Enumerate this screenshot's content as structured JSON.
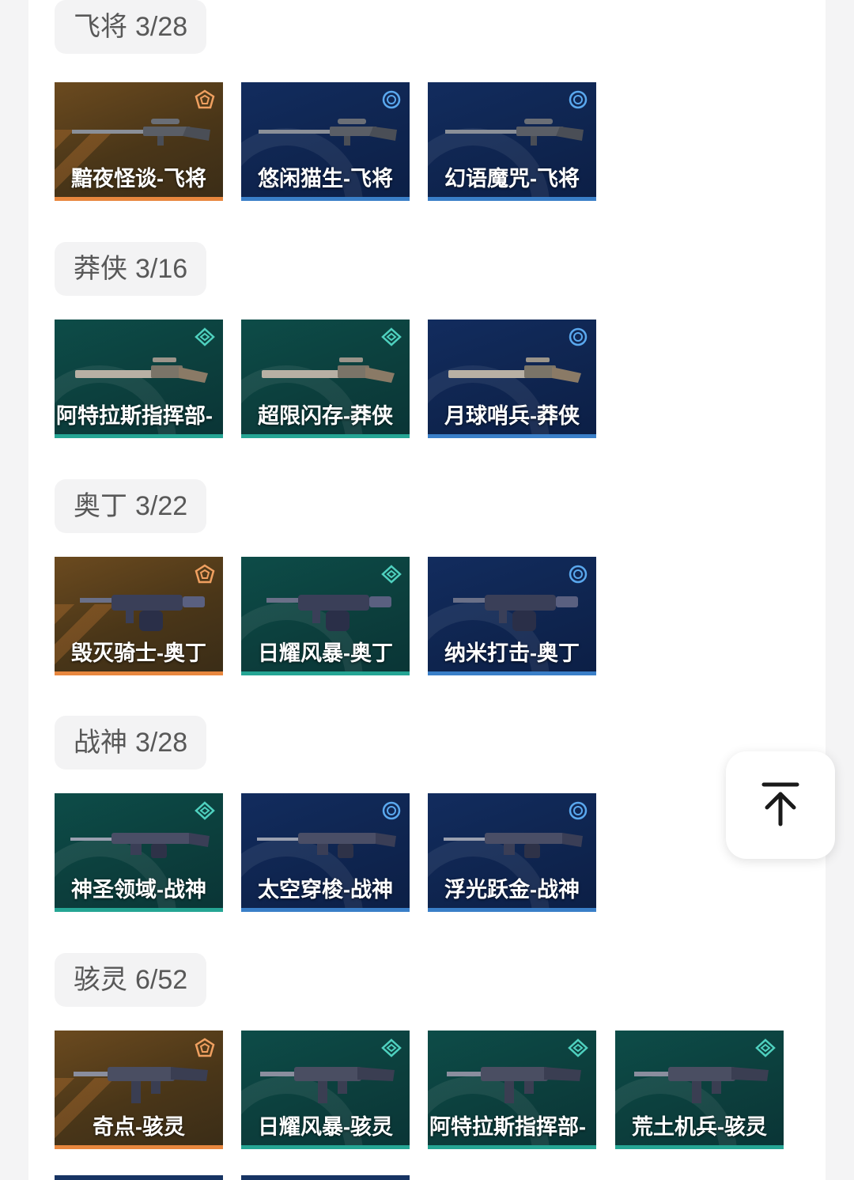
{
  "sections": [
    {
      "name": "飞将",
      "count": "3/28",
      "items": [
        {
          "label": "黯夜怪谈-飞将",
          "tier": "orange",
          "gun": "sniper"
        },
        {
          "label": "悠闲猫生-飞将",
          "tier": "blue",
          "gun": "sniper"
        },
        {
          "label": "幻语魔咒-飞将",
          "tier": "blue",
          "gun": "sniper"
        }
      ]
    },
    {
      "name": "莽侠",
      "count": "3/16",
      "items": [
        {
          "label": "阿特拉斯指挥部-",
          "tier": "teal",
          "gun": "rifle"
        },
        {
          "label": "超限闪存-莽侠",
          "tier": "teal",
          "gun": "rifle"
        },
        {
          "label": "月球哨兵-莽侠",
          "tier": "blue",
          "gun": "rifle"
        }
      ]
    },
    {
      "name": "奥丁",
      "count": "3/22",
      "items": [
        {
          "label": "毁灭骑士-奥丁",
          "tier": "orange",
          "gun": "heavy"
        },
        {
          "label": "日耀风暴-奥丁",
          "tier": "teal",
          "gun": "heavy"
        },
        {
          "label": "纳米打击-奥丁",
          "tier": "blue",
          "gun": "heavy"
        }
      ]
    },
    {
      "name": "战神",
      "count": "3/28",
      "items": [
        {
          "label": "神圣领域-战神",
          "tier": "teal",
          "gun": "lmg"
        },
        {
          "label": "太空穿梭-战神",
          "tier": "blue",
          "gun": "lmg"
        },
        {
          "label": "浮光跃金-战神",
          "tier": "blue",
          "gun": "lmg"
        }
      ]
    },
    {
      "name": "骇灵",
      "count": "6/52",
      "items": [
        {
          "label": "奇点-骇灵",
          "tier": "orange",
          "gun": "smg"
        },
        {
          "label": "日耀风暴-骇灵",
          "tier": "teal",
          "gun": "smg"
        },
        {
          "label": "阿特拉斯指挥部-",
          "tier": "teal",
          "gun": "smg"
        },
        {
          "label": "荒土机兵-骇灵",
          "tier": "teal",
          "gun": "smg"
        }
      ]
    }
  ],
  "icons": {
    "tier_orange": "premium-tier-icon",
    "tier_teal": "select-tier-icon",
    "tier_blue": "deluxe-tier-icon",
    "back_to_top": "arrow-up-to-top-icon"
  },
  "colors": {
    "orange_accent": "#e8873e",
    "teal_accent": "#25a594",
    "blue_accent": "#3a7fc8"
  }
}
